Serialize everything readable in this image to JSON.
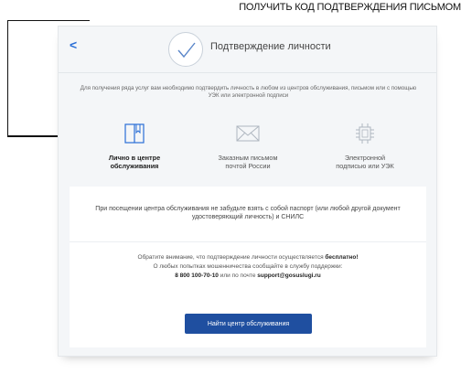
{
  "annotation": {
    "text": "ПОЛУЧИТЬ КОД ПОДТВЕРЖДЕНИЯ ПИСЬМОМ"
  },
  "header": {
    "back_label": "<",
    "title": "Подтверждение личности"
  },
  "intro": "Для получения ряда услуг вам необходимо подтвердить личность в любом из центров обслуживания, письмом или с помощью УЭК или электронной подписи",
  "options": [
    {
      "label_line1": "Лично в центре",
      "label_line2": "обслуживания",
      "icon": "book-icon",
      "active": true
    },
    {
      "label_line1": "Заказным письмом",
      "label_line2": "почтой России",
      "icon": "envelope-icon",
      "active": false
    },
    {
      "label_line1": "Электронной",
      "label_line2": "подписью или УЭК",
      "icon": "chip-icon",
      "active": false
    }
  ],
  "panel": {
    "notice": "При посещении центра обслуживания не забудьте взять с собой паспорт (или любой другой документ удостоверяющий личность) и СНИЛС",
    "note_line1_prefix": "Обратите внимание, что подтверждение личности осуществляется ",
    "note_line1_bold": "бесплатно!",
    "note_line2": "О любых попытках мошенничества сообщайте в службу поддержки:",
    "phone": "8 800 100-70-10",
    "email_prefix": " или по почте ",
    "email": "support@gosuslugi.ru",
    "button_label": "Найти центр обслуживания"
  },
  "colors": {
    "accent": "#1f4fa0",
    "link": "#2a6fd6"
  }
}
